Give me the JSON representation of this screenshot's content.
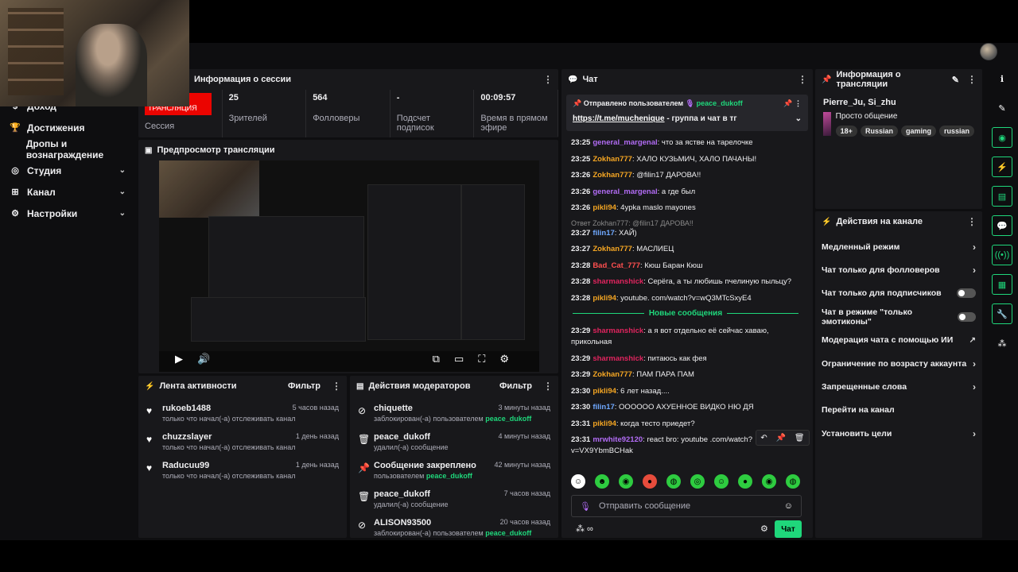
{
  "nav": {
    "items": [
      {
        "label": "Доход",
        "icon": "coin-icon",
        "chevron": false
      },
      {
        "label": "Достижения",
        "icon": "trophy-icon",
        "chevron": false
      },
      {
        "label": "Дропы и вознаграждение",
        "icon": "",
        "chevron": false
      },
      {
        "label": "Студия",
        "icon": "studio-icon",
        "chevron": true
      },
      {
        "label": "Канал",
        "icon": "channel-icon",
        "chevron": true
      },
      {
        "label": "Настройки",
        "icon": "gear-icon",
        "chevron": true
      }
    ]
  },
  "session": {
    "title": "Информация о сессии",
    "live_badge": "ПРЯМАЯ ТРАНСЛЯЦИЯ",
    "stats": [
      {
        "value": "",
        "label": "Сессия"
      },
      {
        "value": "25",
        "label": "Зрителей"
      },
      {
        "value": "564",
        "label": "Фолловеры"
      },
      {
        "value": "-",
        "label": "Подсчет подписок"
      },
      {
        "value": "00:09:57",
        "label": "Время в прямом эфире"
      }
    ]
  },
  "preview": {
    "title": "Предпросмотр трансляции"
  },
  "activity": {
    "title": "Лента активности",
    "filter": "Фильтр",
    "items": [
      {
        "name": "rukoeb1488",
        "sub": "только что начал(-а) отслеживать канал",
        "time": "5 часов назад"
      },
      {
        "name": "chuzzslayer",
        "sub": "только что начал(-а) отслеживать канал",
        "time": "1 день назад"
      },
      {
        "name": "Raducuu99",
        "sub": "только что начал(-а) отслеживать канал",
        "time": "1 день назад"
      }
    ]
  },
  "modactions": {
    "title": "Действия модераторов",
    "filter": "Фильтр",
    "items": [
      {
        "icon": "ban-icon",
        "glyph": "⊘",
        "name": "chiquette",
        "sub": "заблокирован(-а) пользователем",
        "who": "peace_dukoff",
        "time": "3 минуты назад"
      },
      {
        "icon": "trash-icon",
        "glyph": "🗑",
        "name": "peace_dukoff",
        "sub": "удалил(-а) сообщение",
        "who": "",
        "time": "4 минуты назад"
      },
      {
        "icon": "pin-icon",
        "glyph": "📌",
        "name": "Сообщение закреплено",
        "sub": "пользователем",
        "who": "peace_dukoff",
        "time": "42 минуты назад"
      },
      {
        "icon": "trash-icon",
        "glyph": "🗑",
        "name": "peace_dukoff",
        "sub": "удалил(-а) сообщение",
        "who": "",
        "time": "7 часов назад"
      },
      {
        "icon": "ban-icon",
        "glyph": "⊘",
        "name": "ALISON93500",
        "sub": "заблокирован(-а) пользователем",
        "who": "peace_dukoff",
        "time": "20 часов назад"
      }
    ]
  },
  "chat": {
    "title": "Чат",
    "pinned_by_label": "Отправлено пользователем",
    "pinned_by": "peace_dukoff",
    "pinned_link": "https://t.me/muchenique",
    "pinned_text": " - группа и чат в тг",
    "new_messages_label": "Новые сообщения",
    "input_placeholder": "Отправить сообщение",
    "send_label": "Чат",
    "messages_before": [
      {
        "t": "23:25",
        "u": "general_margenal",
        "c": "#b26cf5",
        "m": "что за ястве на тарелочке"
      },
      {
        "t": "23:25",
        "u": "Zokhan777",
        "c": "#f5a623",
        "m": "ХАЛО КУЗЬМИЧ, ХАЛО ПАЧАНЫ!"
      },
      {
        "t": "23:26",
        "u": "Zokhan777",
        "c": "#f5a623",
        "m": "@filin17 ДАРОВА!!"
      },
      {
        "t": "23:26",
        "u": "general_margenal",
        "c": "#b26cf5",
        "m": "а где был"
      },
      {
        "t": "23:26",
        "u": "pikli94",
        "c": "#f5a623",
        "m": "4ypka maslo mayones"
      }
    ],
    "reply_line": "Ответ Zokhan777: @filin17 ДАРОВА!!",
    "messages_mid": [
      {
        "t": "23:27",
        "u": "filin17",
        "c": "#6fa8ff",
        "m": "ХАЙ)"
      },
      {
        "t": "23:27",
        "u": "Zokhan777",
        "c": "#f5a623",
        "m": "МАСЛИЕЦ"
      },
      {
        "t": "23:28",
        "u": "Bad_Cat_777",
        "c": "#ff4f4f",
        "m": "Кюш Баран Кюш"
      },
      {
        "t": "23:28",
        "u": "sharmanshick",
        "c": "#e0245e",
        "m": "Серёга, а ты любишь пчелиную пыльцу?"
      },
      {
        "t": "23:28",
        "u": "pikli94",
        "c": "#f5a623",
        "m": "youtube. com/watch?v=wQ3MTcSxyE4"
      }
    ],
    "messages_after": [
      {
        "t": "23:29",
        "u": "sharmanshick",
        "c": "#e0245e",
        "m": "а я вот отдельно её сейчас хаваю, прикольная"
      },
      {
        "t": "23:29",
        "u": "sharmanshick",
        "c": "#e0245e",
        "m": "питаюсь как фея"
      },
      {
        "t": "23:29",
        "u": "Zokhan777",
        "c": "#f5a623",
        "m": "ПАМ ПАРА ПАМ"
      },
      {
        "t": "23:30",
        "u": "pikli94",
        "c": "#f5a623",
        "m": "6 лет назад...."
      },
      {
        "t": "23:30",
        "u": "filin17",
        "c": "#6fa8ff",
        "m": "ОООООО АХУЕННОЕ ВИДКО НЮ ДЯ"
      },
      {
        "t": "23:31",
        "u": "pikli94",
        "c": "#f5a623",
        "m": "когда тесто приедет?"
      },
      {
        "t": "23:31",
        "u": "mrwhite92120",
        "c": "#b26cf5",
        "m": "react bro: youtube .com/watch?v=VX9YbmBCHak"
      }
    ],
    "emotes": [
      "☺",
      "☻",
      "◉",
      "●",
      "◍",
      "◎",
      "☺",
      "●",
      "◉",
      "◍"
    ]
  },
  "streaminfo": {
    "title": "Информация о трансляции",
    "names": "Pierre_Ju, Si_zhu",
    "stream_title": "Просто общение",
    "tags": [
      "18+",
      "Russian",
      "gaming",
      "russian"
    ]
  },
  "channelactions": {
    "title": "Действия на канале",
    "items": [
      {
        "label": "Медленный режим",
        "kind": "arrow"
      },
      {
        "label": "Чат только для фолловеров",
        "kind": "arrow"
      },
      {
        "label": "Чат только для подписчиков",
        "kind": "toggle"
      },
      {
        "label": "Чат в режиме \"только эмотиконы\"",
        "kind": "toggle"
      },
      {
        "label": "Модерация чата с помощью ИИ",
        "kind": "ext"
      },
      {
        "label": "Ограничение по возрасту аккаунта",
        "kind": "arrow"
      },
      {
        "label": "Запрещенные слова",
        "kind": "arrow"
      },
      {
        "label": "Перейти на канал",
        "kind": "none"
      },
      {
        "label": "Установить цели",
        "kind": "arrow"
      }
    ]
  }
}
